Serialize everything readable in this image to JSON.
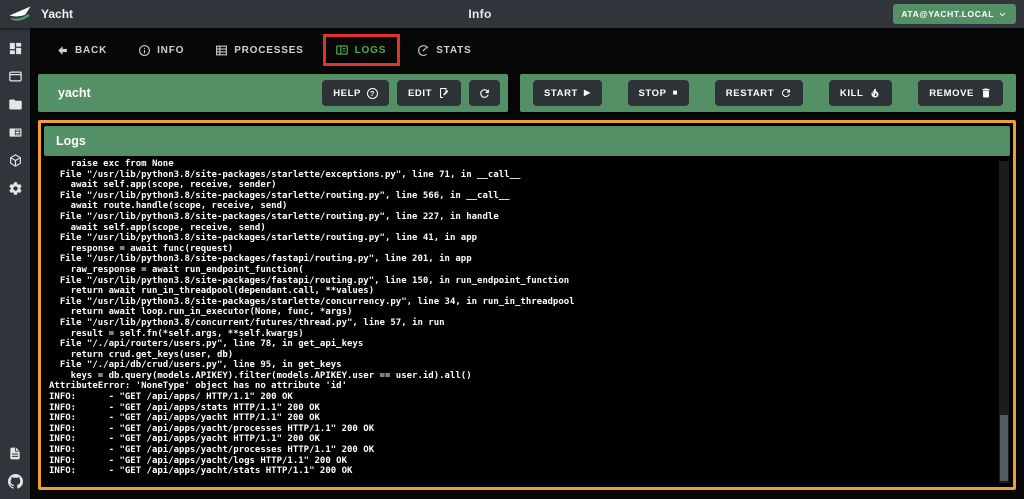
{
  "topbar": {
    "app_title": "Yacht",
    "page_title": "Info",
    "user_menu_label": "ATA@YACHT.LOCAL"
  },
  "sidebar": {
    "items": [
      "dashboard",
      "applications",
      "templates",
      "template-list",
      "projects",
      "settings"
    ],
    "footer_items": [
      "docs",
      "github"
    ]
  },
  "tabs": [
    {
      "label": "BACK"
    },
    {
      "label": "INFO"
    },
    {
      "label": "PROCESSES"
    },
    {
      "label": "LOGS",
      "active": true,
      "annotated": true
    },
    {
      "label": "STATS"
    }
  ],
  "app_bar": {
    "app_name": "yacht",
    "help_label": "HELP",
    "edit_label": "EDIT"
  },
  "action_bar": {
    "start_label": "START",
    "stop_label": "STOP",
    "restart_label": "RESTART",
    "kill_label": "KILL",
    "remove_label": "REMOVE"
  },
  "icons": {
    "play_glyph": "▶",
    "stop_glyph": "■",
    "help_glyph": "?"
  },
  "logs_panel": {
    "title": "Logs",
    "lines": [
      "    raise exc from None",
      "  File \"/usr/lib/python3.8/site-packages/starlette/exceptions.py\", line 71, in __call__",
      "    await self.app(scope, receive, sender)",
      "  File \"/usr/lib/python3.8/site-packages/starlette/routing.py\", line 566, in __call__",
      "    await route.handle(scope, receive, send)",
      "  File \"/usr/lib/python3.8/site-packages/starlette/routing.py\", line 227, in handle",
      "    await self.app(scope, receive, send)",
      "  File \"/usr/lib/python3.8/site-packages/starlette/routing.py\", line 41, in app",
      "    response = await func(request)",
      "  File \"/usr/lib/python3.8/site-packages/fastapi/routing.py\", line 201, in app",
      "    raw_response = await run_endpoint_function(",
      "  File \"/usr/lib/python3.8/site-packages/fastapi/routing.py\", line 150, in run_endpoint_function",
      "    return await run_in_threadpool(dependant.call, **values)",
      "  File \"/usr/lib/python3.8/site-packages/starlette/concurrency.py\", line 34, in run_in_threadpool",
      "    return await loop.run_in_executor(None, func, *args)",
      "  File \"/usr/lib/python3.8/concurrent/futures/thread.py\", line 57, in run",
      "    result = self.fn(*self.args, **self.kwargs)",
      "  File \"/./api/routers/users.py\", line 78, in get_api_keys",
      "    return crud.get_keys(user, db)",
      "  File \"/./api/db/crud/users.py\", line 95, in get_keys",
      "    keys = db.query(models.APIKEY).filter(models.APIKEY.user == user.id).all()",
      "AttributeError: 'NoneType' object has no attribute 'id'",
      "INFO:      - \"GET /api/apps/ HTTP/1.1\" 200 OK",
      "INFO:      - \"GET /api/apps/stats HTTP/1.1\" 200 OK",
      "INFO:      - \"GET /api/apps/yacht HTTP/1.1\" 200 OK",
      "INFO:      - \"GET /api/apps/yacht/processes HTTP/1.1\" 200 OK",
      "INFO:      - \"GET /api/apps/yacht HTTP/1.1\" 200 OK",
      "INFO:      - \"GET /api/apps/yacht/processes HTTP/1.1\" 200 OK",
      "INFO:      - \"GET /api/apps/yacht/logs HTTP/1.1\" 200 OK",
      "INFO:      - \"GET /api/apps/yacht/stats HTTP/1.1\" 200 OK"
    ]
  },
  "colors": {
    "green_bar": "#549066",
    "active_tab_green": "#4caf50",
    "panel_border_orange": "#f0a12d",
    "annotation_red": "#df332f",
    "topbar_bg": "#30353b",
    "button_dark": "#2e3237"
  }
}
